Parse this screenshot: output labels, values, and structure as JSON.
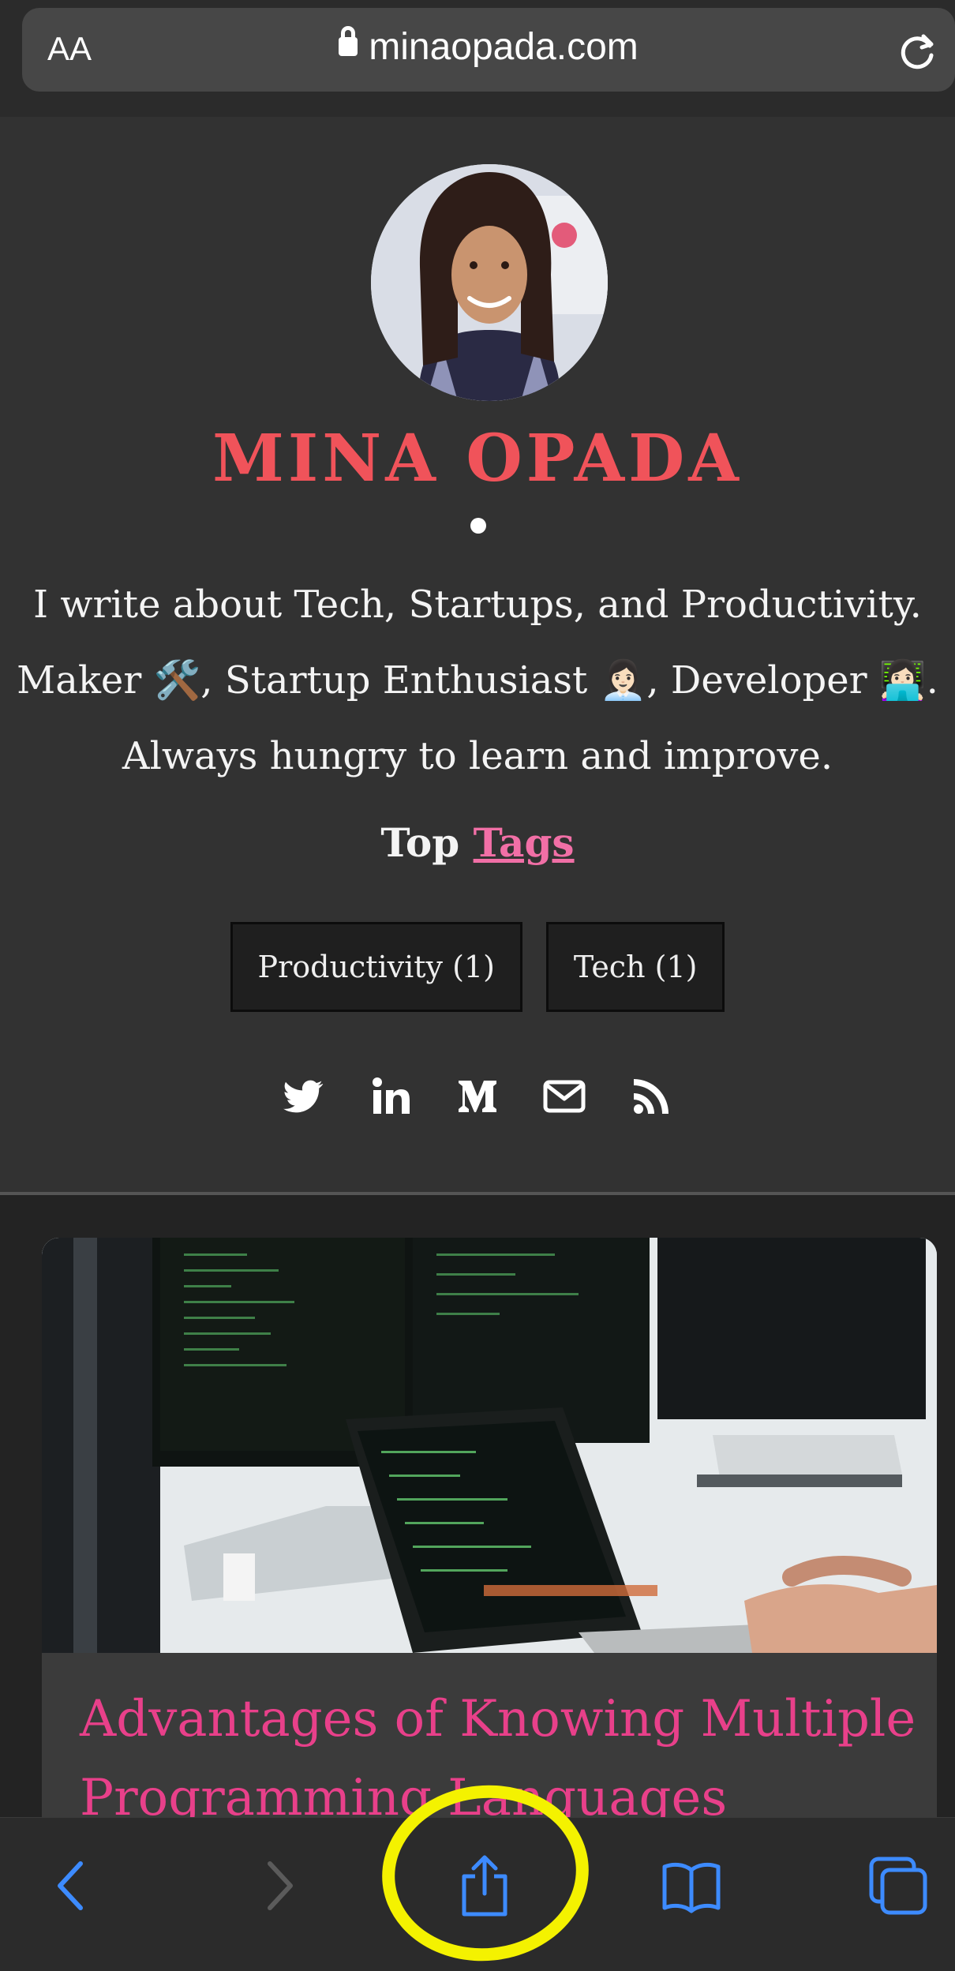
{
  "browser": {
    "text_size_label": "AA",
    "url": "minaopada.com"
  },
  "profile": {
    "name": "MINA OPADA",
    "bio_lines": [
      "I write about Tech, Startups, and Productivity.",
      "Maker 🛠️, Startup Enthusiast 👩🏻‍💼, Developer 👩🏻‍💻.",
      "Always hungry to learn and improve."
    ],
    "top_tags_prefix": "Top",
    "top_tags_link": "Tags",
    "tags": [
      {
        "label": "Productivity (1)"
      },
      {
        "label": "Tech (1)"
      }
    ],
    "social_icons": [
      "twitter-icon",
      "linkedin-icon",
      "medium-icon",
      "mail-icon",
      "rss-icon"
    ]
  },
  "post": {
    "title": "Advantages of Knowing Multiple Programming Languages"
  },
  "toolbar": {
    "icons": [
      "back-icon",
      "forward-icon",
      "share-icon",
      "bookmarks-icon",
      "tabs-icon"
    ]
  },
  "colors": {
    "name": "#f0535a",
    "link": "#f16fa6",
    "post_title": "#e8408a",
    "toolbar_accent": "#3d8bff",
    "highlight": "#f4f200"
  }
}
